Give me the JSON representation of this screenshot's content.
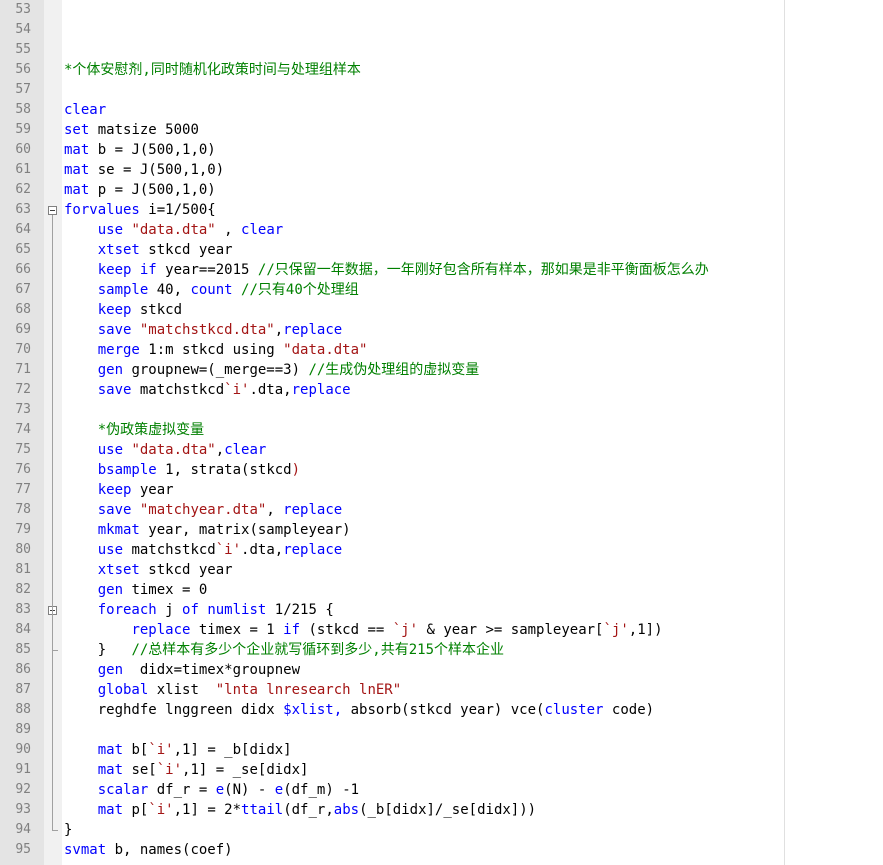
{
  "editor": {
    "lines": [
      {
        "num": "53",
        "segs": []
      },
      {
        "num": "54",
        "segs": []
      },
      {
        "num": "55",
        "segs": []
      },
      {
        "num": "56",
        "segs": [
          {
            "t": "*个体安慰剂,同时随机化政策时间与处理组样本",
            "c": "cm"
          }
        ]
      },
      {
        "num": "57",
        "segs": []
      },
      {
        "num": "58",
        "segs": [
          {
            "t": "clear",
            "c": "kw"
          }
        ]
      },
      {
        "num": "59",
        "segs": [
          {
            "t": "set",
            "c": "kw"
          },
          {
            "t": " matsize 5000",
            "c": ""
          }
        ]
      },
      {
        "num": "60",
        "segs": [
          {
            "t": "mat",
            "c": "kw"
          },
          {
            "t": " b = J(500,1,0)",
            "c": ""
          }
        ]
      },
      {
        "num": "61",
        "segs": [
          {
            "t": "mat",
            "c": "kw"
          },
          {
            "t": " se = J(500,1,0)",
            "c": ""
          }
        ]
      },
      {
        "num": "62",
        "segs": [
          {
            "t": "mat",
            "c": "kw"
          },
          {
            "t": " p = J(500,1,0)",
            "c": ""
          }
        ]
      },
      {
        "num": "63",
        "segs": [
          {
            "t": "forvalues",
            "c": "kw"
          },
          {
            "t": " i=1/500{",
            "c": ""
          }
        ],
        "fold": "start"
      },
      {
        "num": "64",
        "segs": [
          {
            "t": "    ",
            "c": ""
          },
          {
            "t": "use",
            "c": "kw"
          },
          {
            "t": " ",
            "c": ""
          },
          {
            "t": "\"data.dta\"",
            "c": "str"
          },
          {
            "t": " , ",
            "c": ""
          },
          {
            "t": "clear",
            "c": "kw"
          }
        ]
      },
      {
        "num": "65",
        "segs": [
          {
            "t": "    ",
            "c": ""
          },
          {
            "t": "xtset",
            "c": "kw"
          },
          {
            "t": " stkcd year",
            "c": ""
          }
        ]
      },
      {
        "num": "66",
        "segs": [
          {
            "t": "    ",
            "c": ""
          },
          {
            "t": "keep",
            "c": "kw"
          },
          {
            "t": " ",
            "c": ""
          },
          {
            "t": "if",
            "c": "kw"
          },
          {
            "t": " year==2015 ",
            "c": ""
          },
          {
            "t": "//只保留一年数据，一年刚好包含所有样本，那如果是非平衡面板怎么办",
            "c": "cm"
          }
        ]
      },
      {
        "num": "67",
        "segs": [
          {
            "t": "    ",
            "c": ""
          },
          {
            "t": "sample",
            "c": "kw"
          },
          {
            "t": " 40, ",
            "c": ""
          },
          {
            "t": "count",
            "c": "kw"
          },
          {
            "t": " ",
            "c": ""
          },
          {
            "t": "//只有40个处理组",
            "c": "cm"
          }
        ]
      },
      {
        "num": "68",
        "segs": [
          {
            "t": "    ",
            "c": ""
          },
          {
            "t": "keep",
            "c": "kw"
          },
          {
            "t": " stkcd",
            "c": ""
          }
        ]
      },
      {
        "num": "69",
        "segs": [
          {
            "t": "    ",
            "c": ""
          },
          {
            "t": "save",
            "c": "kw"
          },
          {
            "t": " ",
            "c": ""
          },
          {
            "t": "\"matchstkcd.dta\"",
            "c": "str"
          },
          {
            "t": ",",
            "c": ""
          },
          {
            "t": "replace",
            "c": "kw"
          }
        ]
      },
      {
        "num": "70",
        "segs": [
          {
            "t": "    ",
            "c": ""
          },
          {
            "t": "merge",
            "c": "kw"
          },
          {
            "t": " 1:m stkcd using ",
            "c": ""
          },
          {
            "t": "\"data.dta\"",
            "c": "str"
          }
        ]
      },
      {
        "num": "71",
        "segs": [
          {
            "t": "    ",
            "c": ""
          },
          {
            "t": "gen",
            "c": "kw"
          },
          {
            "t": " groupnew=(_merge==3) ",
            "c": ""
          },
          {
            "t": "//生成伪处理组的虚拟变量",
            "c": "cm"
          }
        ]
      },
      {
        "num": "72",
        "segs": [
          {
            "t": "    ",
            "c": ""
          },
          {
            "t": "save",
            "c": "kw"
          },
          {
            "t": " matchstkcd",
            "c": ""
          },
          {
            "t": "`i'",
            "c": "str"
          },
          {
            "t": ".dta,",
            "c": ""
          },
          {
            "t": "replace",
            "c": "kw"
          }
        ]
      },
      {
        "num": "73",
        "segs": []
      },
      {
        "num": "74",
        "segs": [
          {
            "t": "    ",
            "c": ""
          },
          {
            "t": "*伪政策虚拟变量",
            "c": "cm"
          }
        ]
      },
      {
        "num": "75",
        "segs": [
          {
            "t": "    ",
            "c": ""
          },
          {
            "t": "use",
            "c": "kw"
          },
          {
            "t": " ",
            "c": ""
          },
          {
            "t": "\"data.dta\"",
            "c": "str"
          },
          {
            "t": ",",
            "c": ""
          },
          {
            "t": "clear",
            "c": "kw"
          }
        ]
      },
      {
        "num": "76",
        "segs": [
          {
            "t": "    ",
            "c": ""
          },
          {
            "t": "bsample",
            "c": "kw"
          },
          {
            "t": " 1, ",
            "c": ""
          },
          {
            "t": "strata(",
            "c": ""
          },
          {
            "t": "stkcd",
            "c": ""
          },
          {
            "t": ")",
            "c": "str"
          }
        ]
      },
      {
        "num": "77",
        "segs": [
          {
            "t": "    ",
            "c": ""
          },
          {
            "t": "keep",
            "c": "kw"
          },
          {
            "t": " year",
            "c": ""
          }
        ]
      },
      {
        "num": "78",
        "segs": [
          {
            "t": "    ",
            "c": ""
          },
          {
            "t": "save",
            "c": "kw"
          },
          {
            "t": " ",
            "c": ""
          },
          {
            "t": "\"matchyear.dta\"",
            "c": "str"
          },
          {
            "t": ", ",
            "c": ""
          },
          {
            "t": "replace",
            "c": "kw"
          }
        ]
      },
      {
        "num": "79",
        "segs": [
          {
            "t": "    ",
            "c": ""
          },
          {
            "t": "mkmat",
            "c": "kw"
          },
          {
            "t": " year, matrix(sampleyear)",
            "c": ""
          }
        ]
      },
      {
        "num": "80",
        "segs": [
          {
            "t": "    ",
            "c": ""
          },
          {
            "t": "use",
            "c": "kw"
          },
          {
            "t": " matchstkcd",
            "c": ""
          },
          {
            "t": "`i'",
            "c": "str"
          },
          {
            "t": ".dta,",
            "c": ""
          },
          {
            "t": "replace",
            "c": "kw"
          }
        ]
      },
      {
        "num": "81",
        "segs": [
          {
            "t": "    ",
            "c": ""
          },
          {
            "t": "xtset",
            "c": "kw"
          },
          {
            "t": " stkcd year",
            "c": ""
          }
        ]
      },
      {
        "num": "82",
        "segs": [
          {
            "t": "    ",
            "c": ""
          },
          {
            "t": "gen",
            "c": "kw"
          },
          {
            "t": " timex = 0",
            "c": ""
          }
        ]
      },
      {
        "num": "83",
        "segs": [
          {
            "t": "    ",
            "c": ""
          },
          {
            "t": "foreach",
            "c": "kw"
          },
          {
            "t": " j ",
            "c": ""
          },
          {
            "t": "of",
            "c": "kw"
          },
          {
            "t": " ",
            "c": ""
          },
          {
            "t": "numlist",
            "c": "kw"
          },
          {
            "t": " 1/215 {",
            "c": ""
          }
        ],
        "fold": "start"
      },
      {
        "num": "84",
        "segs": [
          {
            "t": "        ",
            "c": ""
          },
          {
            "t": "replace",
            "c": "kw"
          },
          {
            "t": " timex = 1 ",
            "c": ""
          },
          {
            "t": "if",
            "c": "kw"
          },
          {
            "t": " (stkcd == ",
            "c": ""
          },
          {
            "t": "`j'",
            "c": "str"
          },
          {
            "t": " & year >= sampleyear[",
            "c": ""
          },
          {
            "t": "`j'",
            "c": "str"
          },
          {
            "t": ",1])",
            "c": ""
          }
        ]
      },
      {
        "num": "85",
        "segs": [
          {
            "t": "    }   ",
            "c": ""
          },
          {
            "t": "//总样本有多少个企业就写循环到多少,共有215个样本企业",
            "c": "cm"
          }
        ],
        "fold": "end"
      },
      {
        "num": "86",
        "segs": [
          {
            "t": "    ",
            "c": ""
          },
          {
            "t": "gen",
            "c": "kw"
          },
          {
            "t": "  didx=timex*groupnew",
            "c": ""
          }
        ]
      },
      {
        "num": "87",
        "segs": [
          {
            "t": "    ",
            "c": ""
          },
          {
            "t": "global",
            "c": "kw"
          },
          {
            "t": " xlist  ",
            "c": ""
          },
          {
            "t": "\"lnta lnresearch lnER\"",
            "c": "str"
          }
        ]
      },
      {
        "num": "88",
        "segs": [
          {
            "t": "    ",
            "c": ""
          },
          {
            "t": "reghdfe lnggreen didx ",
            "c": ""
          },
          {
            "t": "$xlist,",
            "c": "kw"
          },
          {
            "t": " absorb(stkcd year) vce(",
            "c": ""
          },
          {
            "t": "cluster",
            "c": "kw"
          },
          {
            "t": " code)",
            "c": ""
          }
        ]
      },
      {
        "num": "89",
        "segs": []
      },
      {
        "num": "90",
        "segs": [
          {
            "t": "    ",
            "c": ""
          },
          {
            "t": "mat",
            "c": "kw"
          },
          {
            "t": " b[",
            "c": ""
          },
          {
            "t": "`i'",
            "c": "str"
          },
          {
            "t": ",1] = _b[didx]",
            "c": ""
          }
        ]
      },
      {
        "num": "91",
        "segs": [
          {
            "t": "    ",
            "c": ""
          },
          {
            "t": "mat",
            "c": "kw"
          },
          {
            "t": " se[",
            "c": ""
          },
          {
            "t": "`i'",
            "c": "str"
          },
          {
            "t": ",1] = _se[didx]",
            "c": ""
          }
        ]
      },
      {
        "num": "92",
        "segs": [
          {
            "t": "    ",
            "c": ""
          },
          {
            "t": "scalar",
            "c": "kw"
          },
          {
            "t": " df_r = ",
            "c": ""
          },
          {
            "t": "e",
            "c": "kw"
          },
          {
            "t": "(N) - ",
            "c": ""
          },
          {
            "t": "e",
            "c": "kw"
          },
          {
            "t": "(df_m) -1",
            "c": ""
          }
        ]
      },
      {
        "num": "93",
        "segs": [
          {
            "t": "    ",
            "c": ""
          },
          {
            "t": "mat",
            "c": "kw"
          },
          {
            "t": " p[",
            "c": ""
          },
          {
            "t": "`i'",
            "c": "str"
          },
          {
            "t": ",1] = 2*",
            "c": ""
          },
          {
            "t": "ttail",
            "c": "kw"
          },
          {
            "t": "(df_r,",
            "c": ""
          },
          {
            "t": "abs",
            "c": "kw"
          },
          {
            "t": "(_b[didx]/_se[didx]))",
            "c": ""
          }
        ]
      },
      {
        "num": "94",
        "segs": [
          {
            "t": "}",
            "c": ""
          }
        ],
        "fold": "end"
      },
      {
        "num": "95",
        "segs": [
          {
            "t": "svmat",
            "c": "kw"
          },
          {
            "t": " b, names(coef)",
            "c": ""
          }
        ]
      }
    ]
  }
}
